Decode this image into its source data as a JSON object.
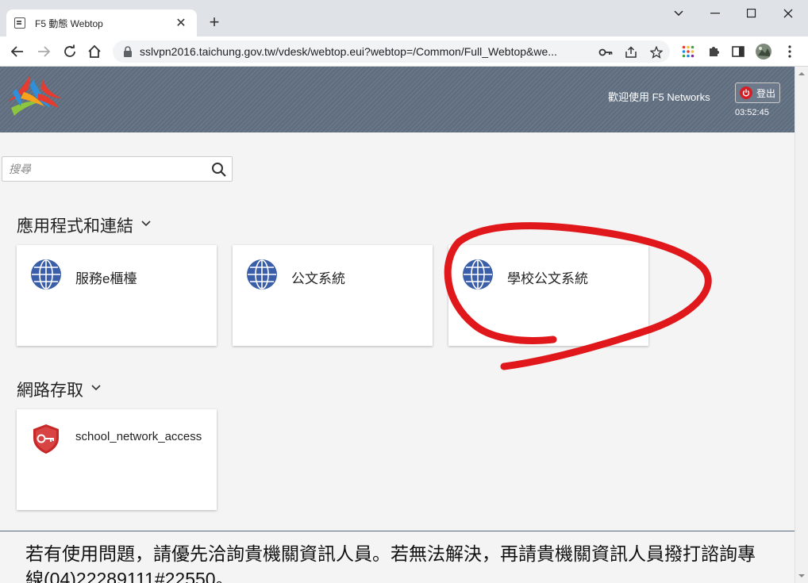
{
  "browser": {
    "tab_title": "F5 動態 Webtop",
    "tab_close": "✕",
    "new_tab": "+",
    "url": "sslvpn2016.taichung.gov.tw/vdesk/webtop.eui?webtop=/Common/Full_Webtop&we..."
  },
  "header": {
    "welcome": "歡迎使用 F5 Networks",
    "logout_label": "登出",
    "clock": "03:52:45"
  },
  "search": {
    "placeholder": "搜尋"
  },
  "sections": [
    {
      "title": "應用程式和連結",
      "items": [
        {
          "label": "服務e櫃檯",
          "icon": "globe-icon"
        },
        {
          "label": "公文系統",
          "icon": "globe-icon"
        },
        {
          "label": "學校公文系統",
          "icon": "globe-icon"
        }
      ]
    },
    {
      "title": "網路存取",
      "items": [
        {
          "label": "school_network_access",
          "icon": "network-access-shield-icon"
        }
      ]
    }
  ],
  "footer": {
    "notice": "若有使用問題，請優先洽詢貴機關資訊人員。若無法解決，再請貴機關資訊人員撥打諮詢專線(04)22289111#22550。"
  },
  "colors": {
    "header_bg": "#64717f",
    "logout_power": "#d32026",
    "globe": "#3b5ea8",
    "annotation_red": "#e0181c"
  }
}
